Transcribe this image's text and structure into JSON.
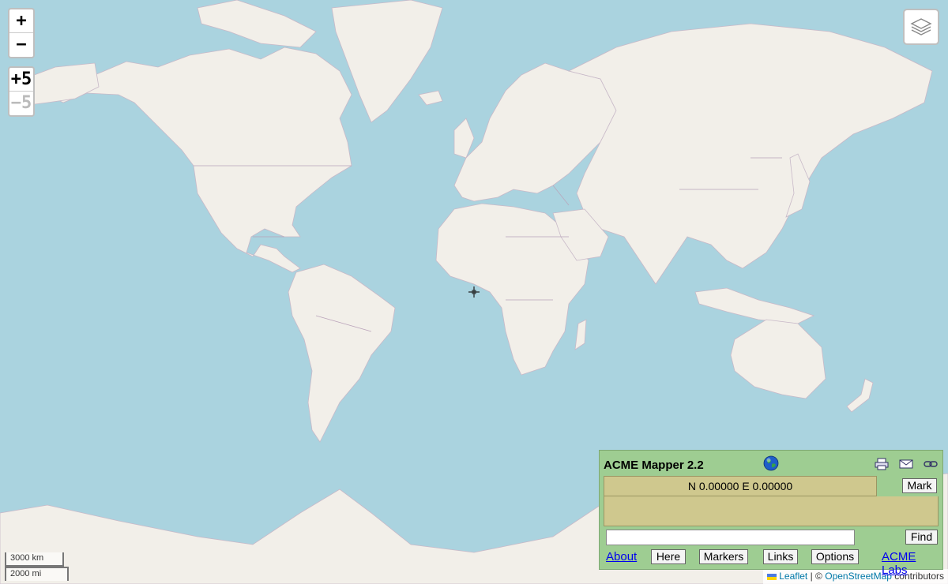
{
  "map": {
    "zoom_in_label": "+",
    "zoom_out_label": "−",
    "zoom_in5_label": "+5",
    "zoom_out5_label": "−5",
    "layers_icon": "layers-icon",
    "crosshair_icon": "crosshair-icon",
    "colors": {
      "water": "#aad3df",
      "land": "#f2efe9",
      "border": "#b9a3b9"
    }
  },
  "scale": {
    "metric": "3000 km",
    "imperial": "2000 mi"
  },
  "attribution": {
    "leaflet": "Leaflet",
    "separator": "| ©",
    "osm": "OpenStreetMap",
    "suffix": "contributors"
  },
  "panel": {
    "title": "ACME Mapper 2.2",
    "coords": "N 0.00000 E 0.00000",
    "mark_label": "Mark",
    "search_value": "",
    "find_label": "Find",
    "about_label": "About",
    "here_label": "Here",
    "markers_label": "Markers",
    "links_label": "Links",
    "options_label": "Options",
    "acme_labs_label": "ACME Labs",
    "icons": [
      "globe-icon",
      "print-icon",
      "email-icon",
      "link-icon"
    ]
  }
}
